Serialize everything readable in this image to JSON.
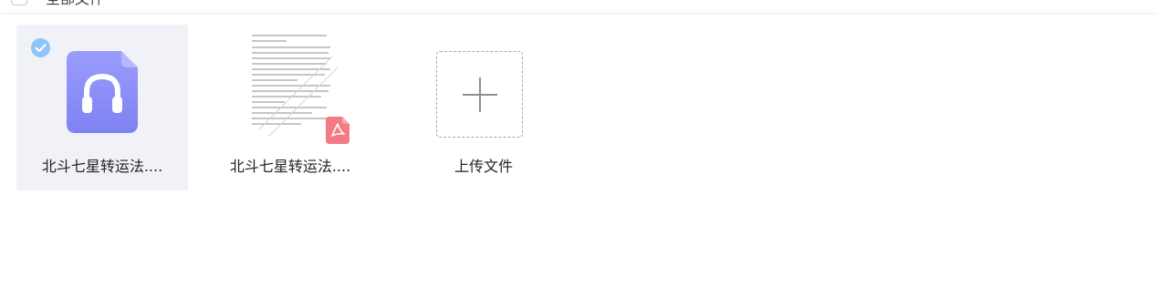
{
  "header": {
    "select_all_label": "全部文件"
  },
  "files": [
    {
      "name": "北斗七星转运法....",
      "type": "audio",
      "selected": true,
      "icon": "headphones-icon",
      "accent": "#8a8cf7"
    },
    {
      "name": "北斗七星转运法....",
      "type": "pdf",
      "selected": false,
      "icon": "pdf-icon",
      "accent": "#f27b85"
    }
  ],
  "upload": {
    "label": "上传文件",
    "icon": "plus-icon"
  },
  "colors": {
    "selected_bg": "#f1f2f7",
    "check": "#8ec4f7",
    "dashed_border": "#a3a7b2"
  }
}
